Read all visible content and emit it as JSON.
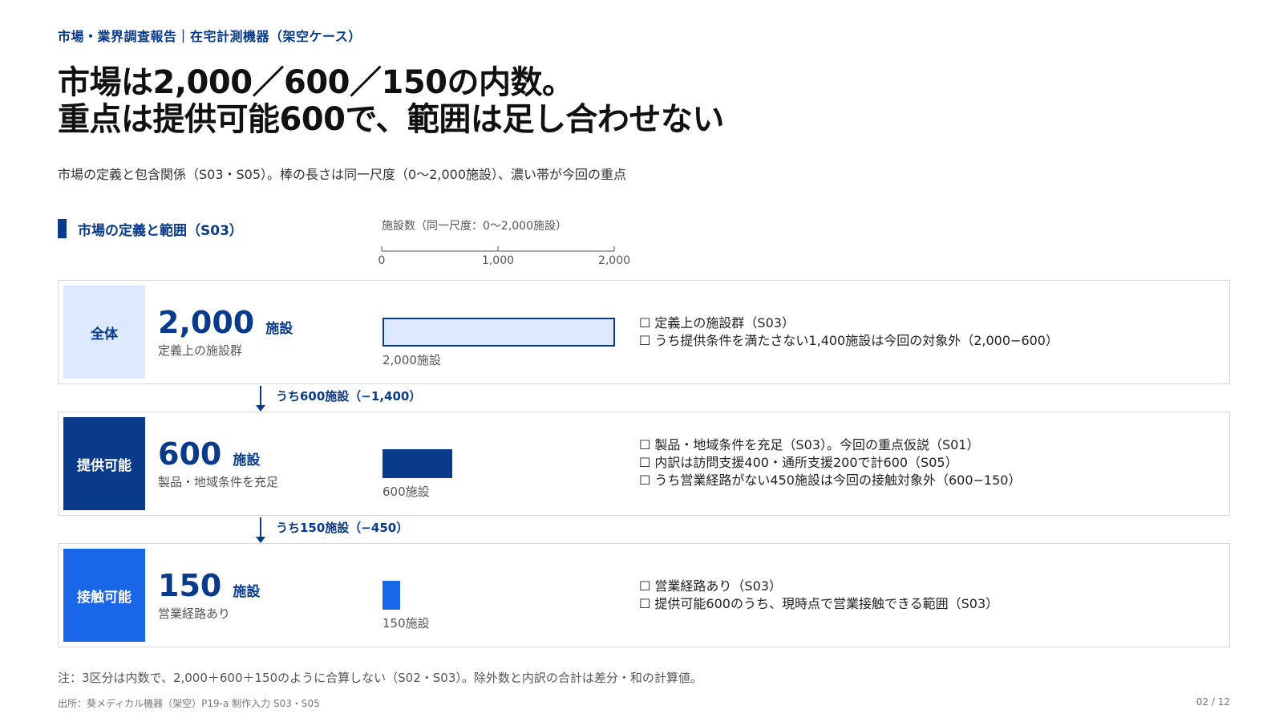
{
  "header": {
    "tag": "市場・業界調査報告｜在宅計測機器（架空ケース）",
    "title_line1": "市場は2,000／600／150の内数。",
    "title_line2": "重点は提供可能600で、範囲は足し合わせない",
    "subtitle": "市場の定義と包含関係（S03・S05）。棒の長さは同一尺度（0〜2,000施設）、濃い帯が今回の重点"
  },
  "section": {
    "label": "市場の定義と範囲（S03）"
  },
  "colors": {
    "accent": "#0a3a8a",
    "row1_label_bg": "#dce8fb",
    "row1_bar_fill": "#dce8fb",
    "row2": "#0a3a8a",
    "row3": "#1a66e8"
  },
  "chart_data": {
    "type": "bar",
    "orientation": "horizontal",
    "axis_title": "施設数（同一尺度：0〜2,000施設）",
    "xlim": [
      0,
      2000
    ],
    "ticks": [
      0,
      1000,
      2000
    ],
    "tick_labels": [
      "0",
      "1,000",
      "2,000"
    ],
    "categories": [
      "全体",
      "提供可能",
      "接触可能"
    ],
    "values": [
      2000,
      600,
      150
    ],
    "value_labels": [
      "2,000施設",
      "600施設",
      "150施設"
    ]
  },
  "rows": [
    {
      "label": "全体",
      "big_value": "2,000",
      "unit": "施設",
      "desc": "定義上の施設群",
      "notes": [
        "☐ 定義上の施設群（S03）",
        "☐ うち提供条件を満たさない1,400施設は今回の対象外（2,000−600）"
      ]
    },
    {
      "label": "提供可能",
      "big_value": "600",
      "unit": "施設",
      "desc": "製品・地域条件を充足",
      "notes": [
        "☐ 製品・地域条件を充足（S03）。今回の重点仮説（S01）",
        "☐ 内訳は訪問支援400・通所支援200で計600（S05）",
        "☐ うち営業経路がない450施設は今回の接触対象外（600−150）"
      ]
    },
    {
      "label": "接触可能",
      "big_value": "150",
      "unit": "施設",
      "desc": "営業経路あり",
      "notes": [
        "☐ 営業経路あり（S03）",
        "☐ 提供可能600のうち、現時点で営業接触できる範囲（S03）"
      ]
    }
  ],
  "arrows": [
    {
      "text": "うち600施設（−1,400）"
    },
    {
      "text": "うち150施設（−450）"
    }
  ],
  "footer": {
    "note": "注：3区分は内数で、2,000＋600＋150のように合算しない（S02・S03）。除外数と内訳の合計は差分・和の計算値。",
    "source": "出所：葵メディカル機器（架空）P19-a 制作入力 S03・S05",
    "page": "02 / 12"
  }
}
